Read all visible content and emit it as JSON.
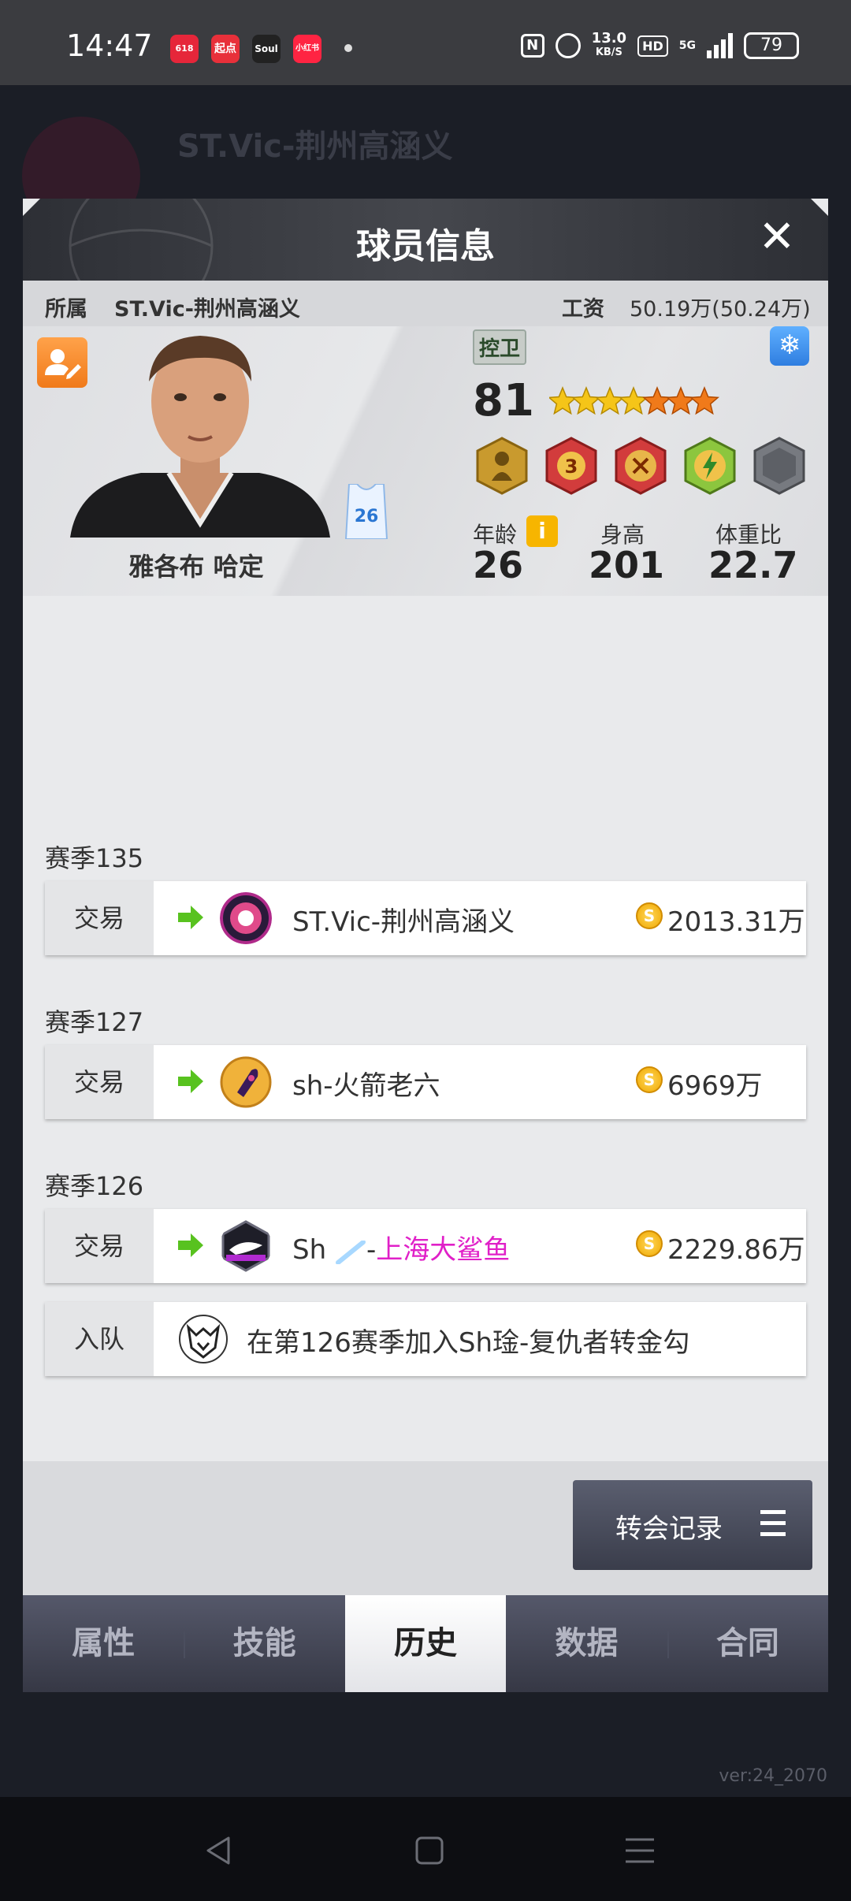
{
  "status_bar": {
    "time": "14:47",
    "apps": [
      "618",
      "起点",
      "Soul",
      "小红书"
    ],
    "nfc": "N",
    "speed_value": "13.0",
    "speed_unit": "KB/S",
    "hd": "HD",
    "network": "5G",
    "battery": "79"
  },
  "background": {
    "title": "ST.Vic-荆州高涵义",
    "version": "ver:24_2070"
  },
  "modal": {
    "title": "球员信息",
    "close_icon": "close-icon",
    "team_label": "所属",
    "team_name": "ST.Vic-荆州高涵义",
    "salary_label": "工资",
    "salary_value": "50.19万(50.24万)"
  },
  "player": {
    "name": "雅各布 哈定",
    "jersey_number": "26",
    "position": "控卫",
    "rating": "81",
    "stars_gold": 4,
    "stars_orange": 3,
    "badges": [
      "player-badge",
      "level-3-badge",
      "bust-badge",
      "lightning-badge",
      "empty-hex-badge"
    ],
    "age_label": "年龄",
    "age": "26",
    "height_label": "身高",
    "height": "201",
    "weight_label": "体重比",
    "weight": "22.7",
    "info_icon": "i"
  },
  "history": [
    {
      "season": "赛季135",
      "type": "交易",
      "team": "ST.Vic-荆州高涵义",
      "team_suffix": "",
      "fee": "2013.31万"
    },
    {
      "season": "赛季127",
      "type": "交易",
      "team": "sh-火箭老六",
      "team_suffix": "",
      "fee": "6969万"
    },
    {
      "season": "赛季126",
      "type": "交易",
      "team": "Sh",
      "team_suffix": "上海大鲨鱼",
      "fee": "2229.86万"
    },
    {
      "season": "",
      "type": "入队",
      "team": "在第126赛季加入Sh琻-复仇者转金勾",
      "team_suffix": "",
      "fee": ""
    }
  ],
  "transfer_button": "转会记录",
  "tabs": [
    {
      "label": "属性",
      "active": false
    },
    {
      "label": "技能",
      "active": false
    },
    {
      "label": "历史",
      "active": true
    },
    {
      "label": "数据",
      "active": false
    },
    {
      "label": "合同",
      "active": false
    }
  ],
  "colors": {
    "accent_orange": "#f07a1a",
    "pink_text": "#e020c8",
    "arrow_green": "#58c21f"
  }
}
